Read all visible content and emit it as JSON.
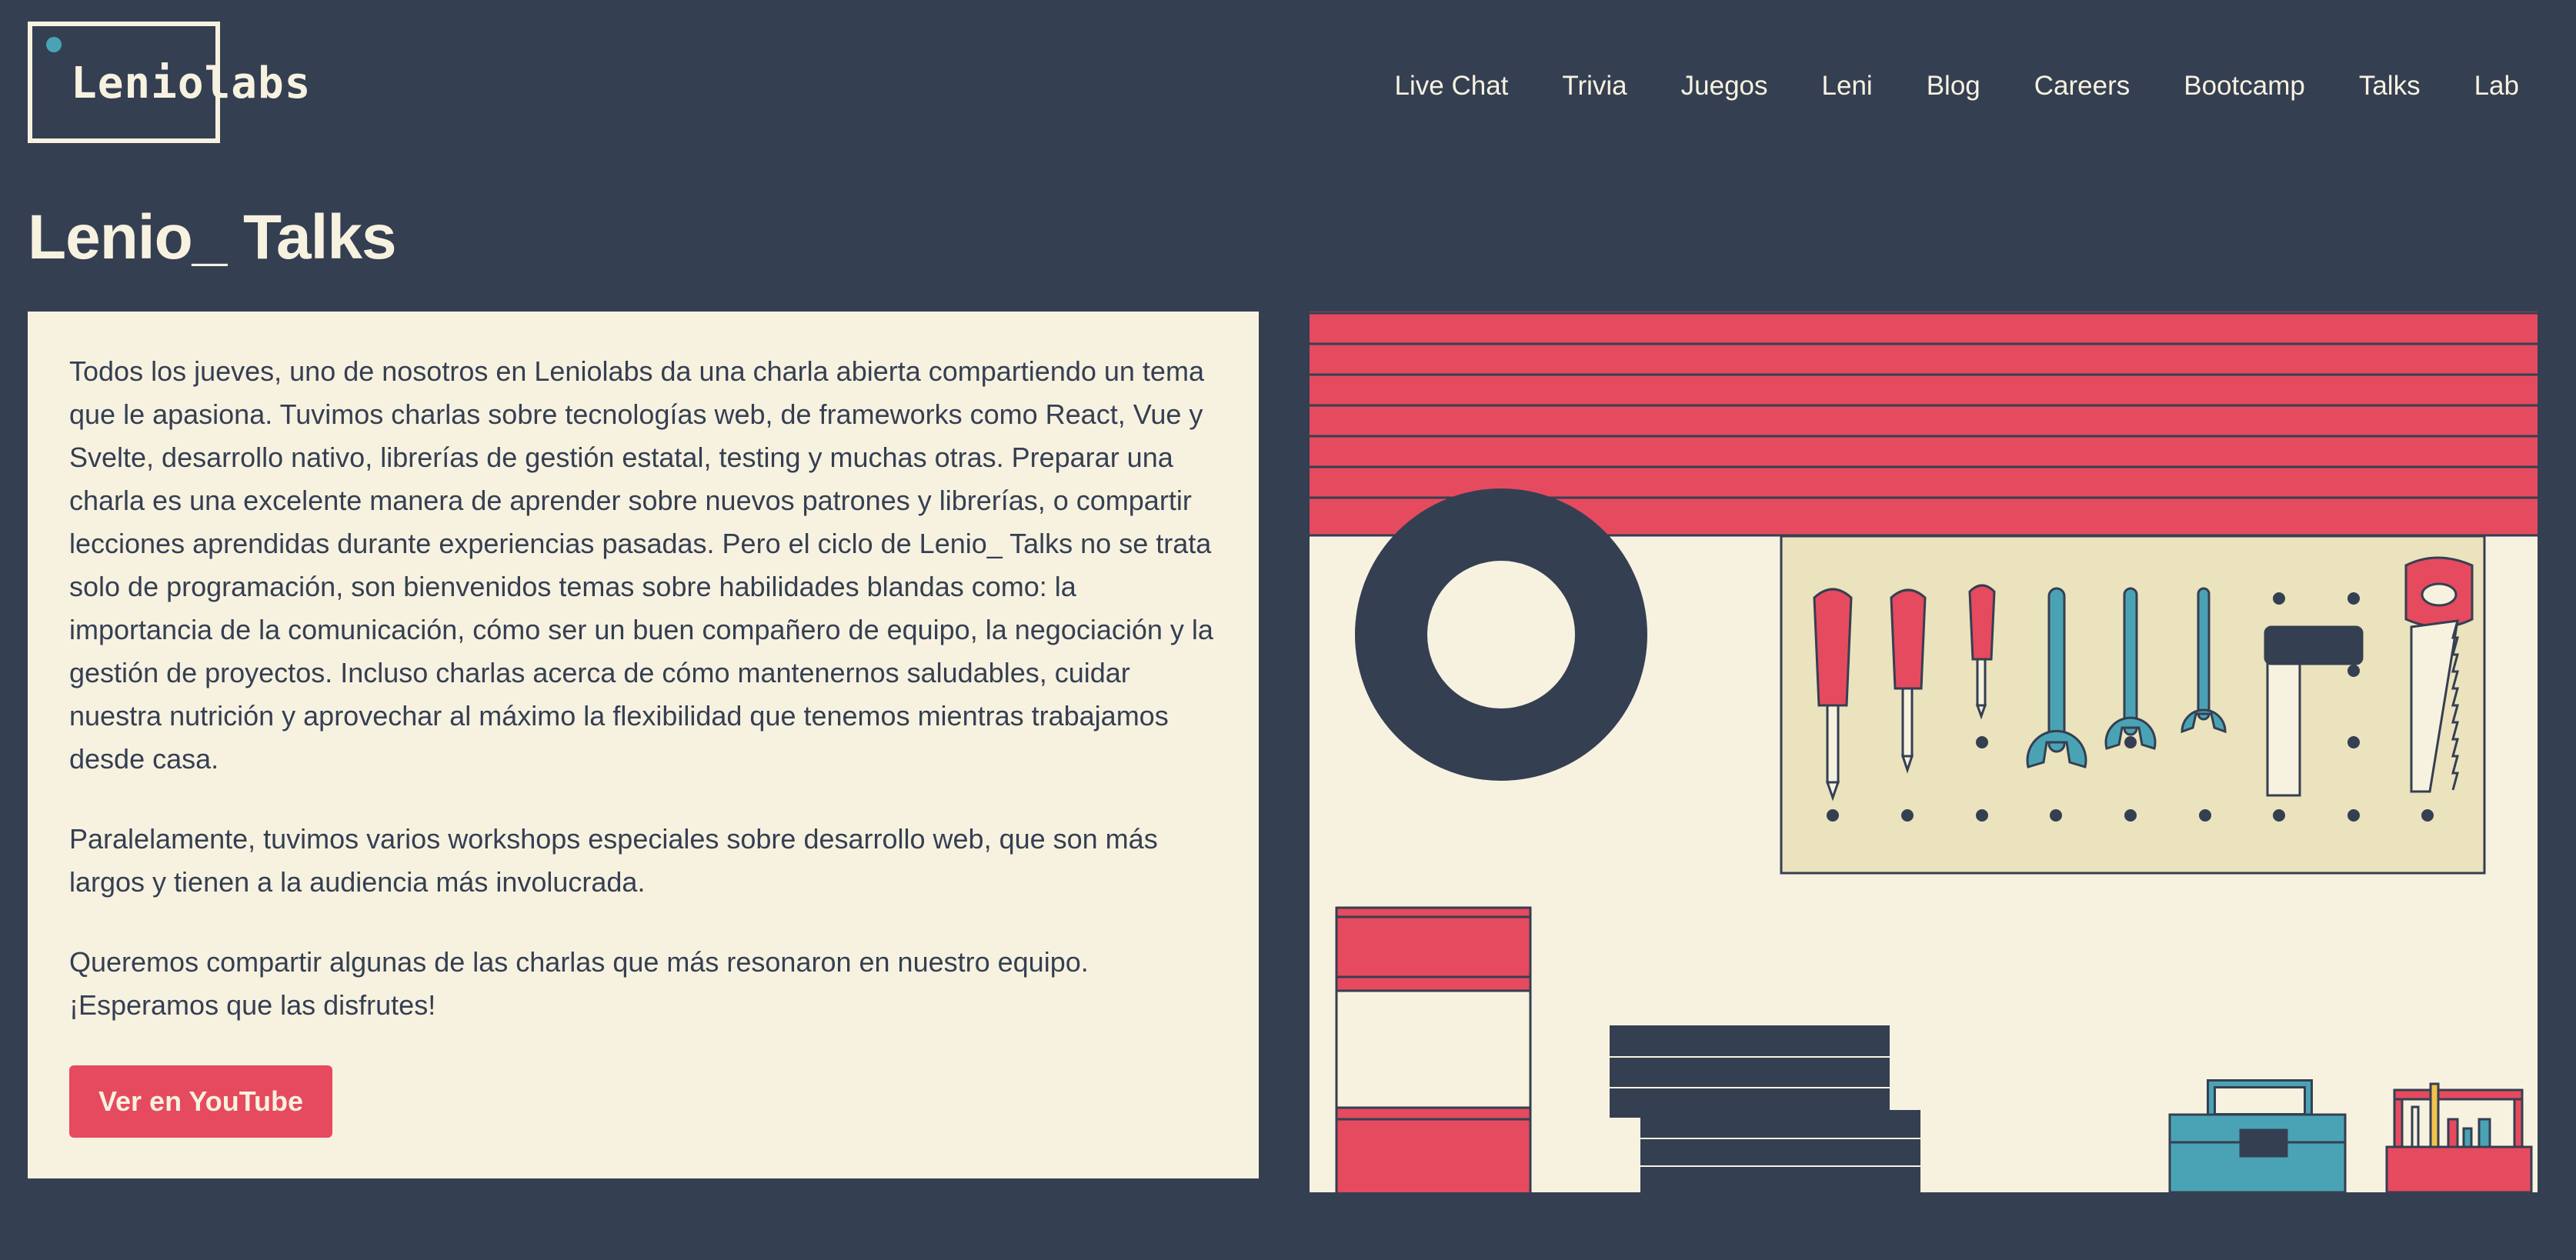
{
  "brand": {
    "logo_text": "Leniolabs"
  },
  "nav": {
    "items": [
      "Live Chat",
      "Trivia",
      "Juegos",
      "Leni",
      "Blog",
      "Careers",
      "Bootcamp",
      "Talks",
      "Lab"
    ]
  },
  "page": {
    "title": "Lenio_ Talks"
  },
  "content": {
    "paragraphs": [
      "Todos los jueves, uno de nosotros en Leniolabs da una charla abierta compartiendo un tema que le apasiona. Tuvimos charlas sobre tecnologías web, de frameworks como React, Vue y Svelte, desarrollo nativo, librerías de gestión estatal, testing y muchas otras. Preparar una charla es una excelente manera de aprender sobre nuevos patrones y librerías, o compartir lecciones aprendidas durante experiencias pasadas. Pero el ciclo de Lenio_ Talks no se trata solo de programación, son bienvenidos temas sobre habilidades blandas como: la importancia de la comunicación, cómo ser un buen compañero de equipo, la negociación y la gestión de proyectos. Incluso charlas acerca de cómo mantenernos saludables, cuidar nuestra nutrición y aprovechar al máximo la flexibilidad que tenemos mientras trabajamos desde casa.",
      "Paralelamente, tuvimos varios workshops especiales sobre desarrollo web, que son más largos y tienen a la audiencia más involucrada.",
      "Queremos compartir algunas de las charlas que más resonaron en nuestro equipo. ¡Esperamos que las disfrutes!"
    ],
    "button_label": "Ver en YouTube"
  },
  "colors": {
    "background": "#353f52",
    "cream": "#f7f2e0",
    "accent_red": "#e64a5f",
    "accent_blue": "#4aa3b5",
    "pegboard": "#ebe3bd"
  },
  "illustration": {
    "icons": [
      "garage-door-icon",
      "tire-icon",
      "pegboard-icon",
      "screwdriver-icon",
      "wrench-icon",
      "hammer-icon",
      "saw-icon",
      "barrel-icon",
      "stacked-boxes-icon",
      "toolbox-icon",
      "tool-caddy-icon"
    ]
  }
}
